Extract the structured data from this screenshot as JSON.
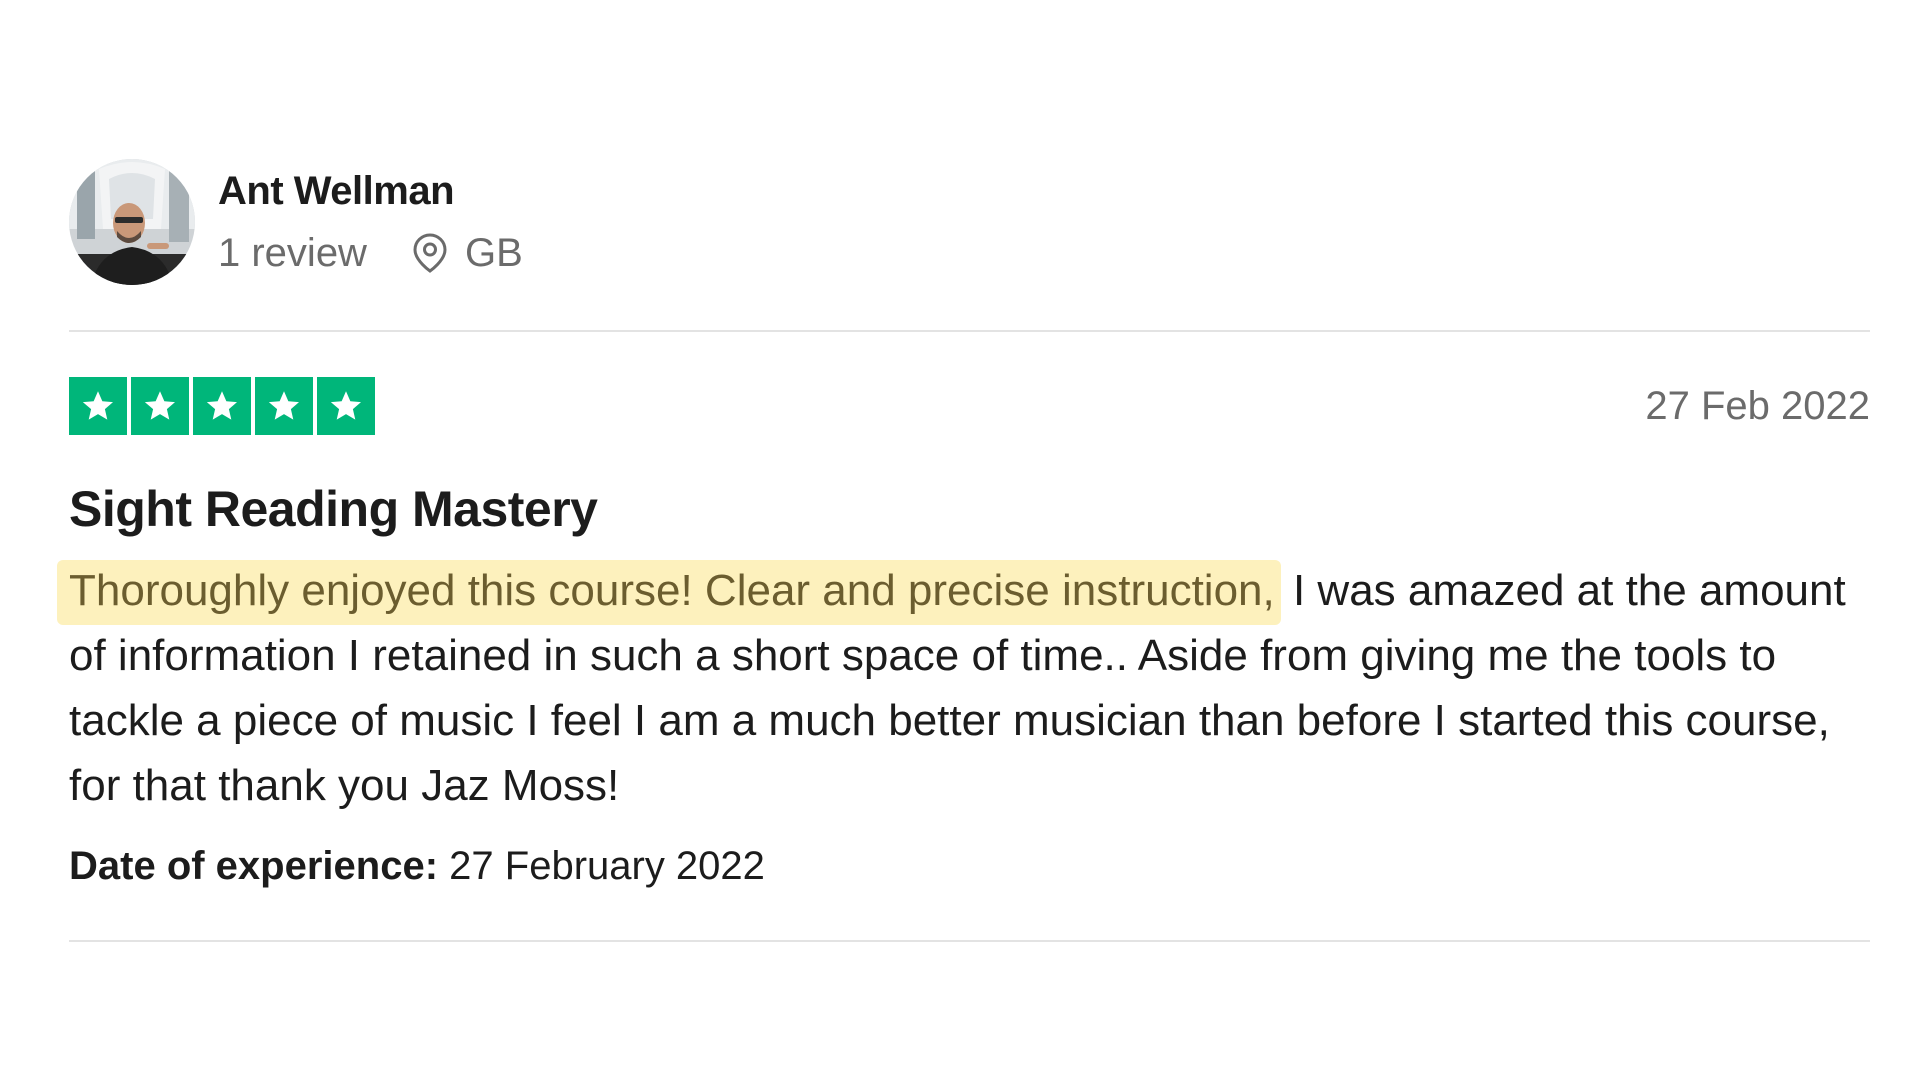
{
  "author": {
    "name": "Ant Wellman",
    "reviews_count": "1 review",
    "location": "GB",
    "avatar_icon": "user-photo",
    "location_icon": "map-pin-icon"
  },
  "review": {
    "rating": 5,
    "rating_max": 5,
    "star_color": "#00b67a",
    "date": "27 Feb 2022",
    "title": "Sight Reading Mastery",
    "body_highlight": "Thoroughly enjoyed this course! Clear and precise instruction,",
    "body_rest": " I was amazed at the amount of information I retained in such a short space of time.. Aside from giving me the tools to tackle a piece of music I feel I am a much better musician than before I started this course, for that thank you Jaz Moss!",
    "experience_label": "Date of experience:",
    "experience_date": "27 February 2022"
  },
  "colors": {
    "highlight_bg": "#fdf1bd",
    "highlight_text": "#6b5d2f",
    "divider": "#e3e3e3"
  }
}
